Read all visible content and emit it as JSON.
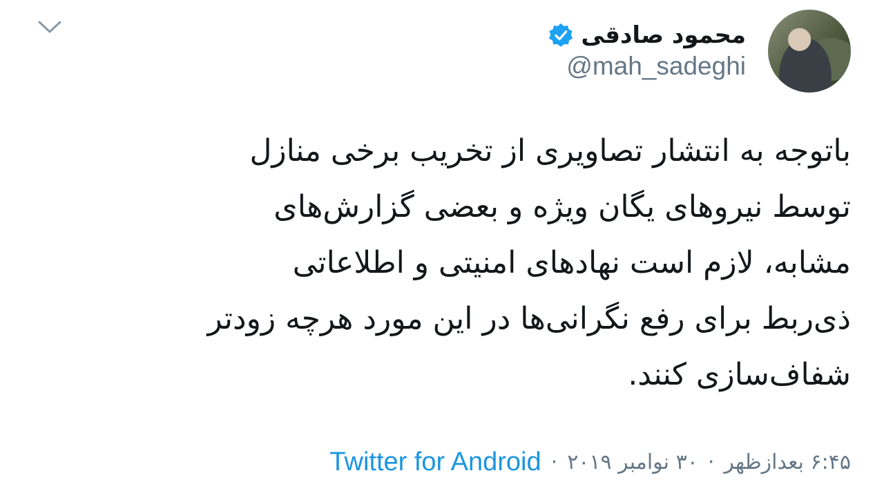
{
  "header": {
    "display_name": "محمود صادقی",
    "handle": "@mah_sadeghi",
    "verified_icon": "verified-badge-icon",
    "collapse_icon": "chevron-down-icon"
  },
  "tweet": {
    "lines": [
      "باتوجه به انتشار تصاویری از تخریب برخی منازل",
      "توسط نیروهای یگان ویژه و بعضی گزارش‌های",
      "مشابه، لازم است نهادهای امنیتی و اطلاعاتی",
      "ذی‌ربط برای رفع نگرانی‌ها در این مورد هرچه زودتر",
      "شفاف‌سازی کنند."
    ]
  },
  "meta": {
    "time": "۶:۴۵ بعدازظهر",
    "separator": "·",
    "date": "۳۰ نوامبر ۲۰۱۹",
    "source": "Twitter for Android"
  },
  "colors": {
    "text": "#14171a",
    "muted": "#657786",
    "link": "#1b95e0",
    "verified": "#1da1f2"
  }
}
